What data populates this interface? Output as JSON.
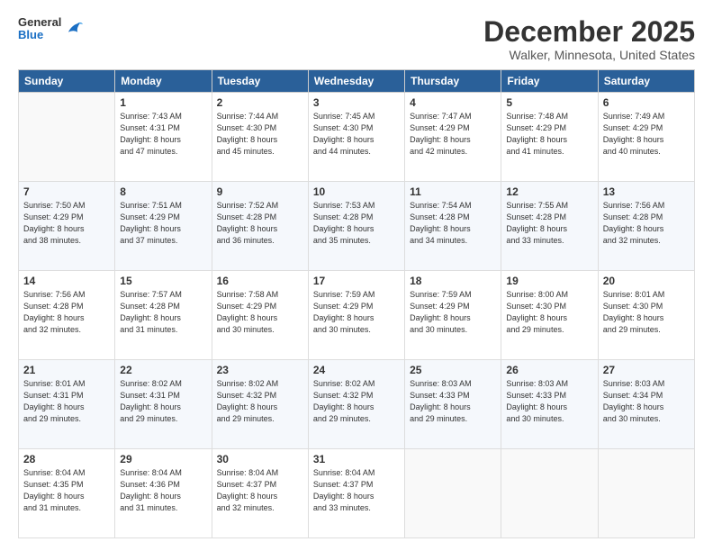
{
  "header": {
    "logo": {
      "general": "General",
      "blue": "Blue"
    },
    "title": "December 2025",
    "subtitle": "Walker, Minnesota, United States"
  },
  "weekdays": [
    "Sunday",
    "Monday",
    "Tuesday",
    "Wednesday",
    "Thursday",
    "Friday",
    "Saturday"
  ],
  "weeks": [
    [
      {
        "day": "",
        "info": ""
      },
      {
        "day": "1",
        "info": "Sunrise: 7:43 AM\nSunset: 4:31 PM\nDaylight: 8 hours\nand 47 minutes."
      },
      {
        "day": "2",
        "info": "Sunrise: 7:44 AM\nSunset: 4:30 PM\nDaylight: 8 hours\nand 45 minutes."
      },
      {
        "day": "3",
        "info": "Sunrise: 7:45 AM\nSunset: 4:30 PM\nDaylight: 8 hours\nand 44 minutes."
      },
      {
        "day": "4",
        "info": "Sunrise: 7:47 AM\nSunset: 4:29 PM\nDaylight: 8 hours\nand 42 minutes."
      },
      {
        "day": "5",
        "info": "Sunrise: 7:48 AM\nSunset: 4:29 PM\nDaylight: 8 hours\nand 41 minutes."
      },
      {
        "day": "6",
        "info": "Sunrise: 7:49 AM\nSunset: 4:29 PM\nDaylight: 8 hours\nand 40 minutes."
      }
    ],
    [
      {
        "day": "7",
        "info": "Sunrise: 7:50 AM\nSunset: 4:29 PM\nDaylight: 8 hours\nand 38 minutes."
      },
      {
        "day": "8",
        "info": "Sunrise: 7:51 AM\nSunset: 4:29 PM\nDaylight: 8 hours\nand 37 minutes."
      },
      {
        "day": "9",
        "info": "Sunrise: 7:52 AM\nSunset: 4:28 PM\nDaylight: 8 hours\nand 36 minutes."
      },
      {
        "day": "10",
        "info": "Sunrise: 7:53 AM\nSunset: 4:28 PM\nDaylight: 8 hours\nand 35 minutes."
      },
      {
        "day": "11",
        "info": "Sunrise: 7:54 AM\nSunset: 4:28 PM\nDaylight: 8 hours\nand 34 minutes."
      },
      {
        "day": "12",
        "info": "Sunrise: 7:55 AM\nSunset: 4:28 PM\nDaylight: 8 hours\nand 33 minutes."
      },
      {
        "day": "13",
        "info": "Sunrise: 7:56 AM\nSunset: 4:28 PM\nDaylight: 8 hours\nand 32 minutes."
      }
    ],
    [
      {
        "day": "14",
        "info": "Sunrise: 7:56 AM\nSunset: 4:28 PM\nDaylight: 8 hours\nand 32 minutes."
      },
      {
        "day": "15",
        "info": "Sunrise: 7:57 AM\nSunset: 4:28 PM\nDaylight: 8 hours\nand 31 minutes."
      },
      {
        "day": "16",
        "info": "Sunrise: 7:58 AM\nSunset: 4:29 PM\nDaylight: 8 hours\nand 30 minutes."
      },
      {
        "day": "17",
        "info": "Sunrise: 7:59 AM\nSunset: 4:29 PM\nDaylight: 8 hours\nand 30 minutes."
      },
      {
        "day": "18",
        "info": "Sunrise: 7:59 AM\nSunset: 4:29 PM\nDaylight: 8 hours\nand 30 minutes."
      },
      {
        "day": "19",
        "info": "Sunrise: 8:00 AM\nSunset: 4:30 PM\nDaylight: 8 hours\nand 29 minutes."
      },
      {
        "day": "20",
        "info": "Sunrise: 8:01 AM\nSunset: 4:30 PM\nDaylight: 8 hours\nand 29 minutes."
      }
    ],
    [
      {
        "day": "21",
        "info": "Sunrise: 8:01 AM\nSunset: 4:31 PM\nDaylight: 8 hours\nand 29 minutes."
      },
      {
        "day": "22",
        "info": "Sunrise: 8:02 AM\nSunset: 4:31 PM\nDaylight: 8 hours\nand 29 minutes."
      },
      {
        "day": "23",
        "info": "Sunrise: 8:02 AM\nSunset: 4:32 PM\nDaylight: 8 hours\nand 29 minutes."
      },
      {
        "day": "24",
        "info": "Sunrise: 8:02 AM\nSunset: 4:32 PM\nDaylight: 8 hours\nand 29 minutes."
      },
      {
        "day": "25",
        "info": "Sunrise: 8:03 AM\nSunset: 4:33 PM\nDaylight: 8 hours\nand 29 minutes."
      },
      {
        "day": "26",
        "info": "Sunrise: 8:03 AM\nSunset: 4:33 PM\nDaylight: 8 hours\nand 30 minutes."
      },
      {
        "day": "27",
        "info": "Sunrise: 8:03 AM\nSunset: 4:34 PM\nDaylight: 8 hours\nand 30 minutes."
      }
    ],
    [
      {
        "day": "28",
        "info": "Sunrise: 8:04 AM\nSunset: 4:35 PM\nDaylight: 8 hours\nand 31 minutes."
      },
      {
        "day": "29",
        "info": "Sunrise: 8:04 AM\nSunset: 4:36 PM\nDaylight: 8 hours\nand 31 minutes."
      },
      {
        "day": "30",
        "info": "Sunrise: 8:04 AM\nSunset: 4:37 PM\nDaylight: 8 hours\nand 32 minutes."
      },
      {
        "day": "31",
        "info": "Sunrise: 8:04 AM\nSunset: 4:37 PM\nDaylight: 8 hours\nand 33 minutes."
      },
      {
        "day": "",
        "info": ""
      },
      {
        "day": "",
        "info": ""
      },
      {
        "day": "",
        "info": ""
      }
    ]
  ]
}
